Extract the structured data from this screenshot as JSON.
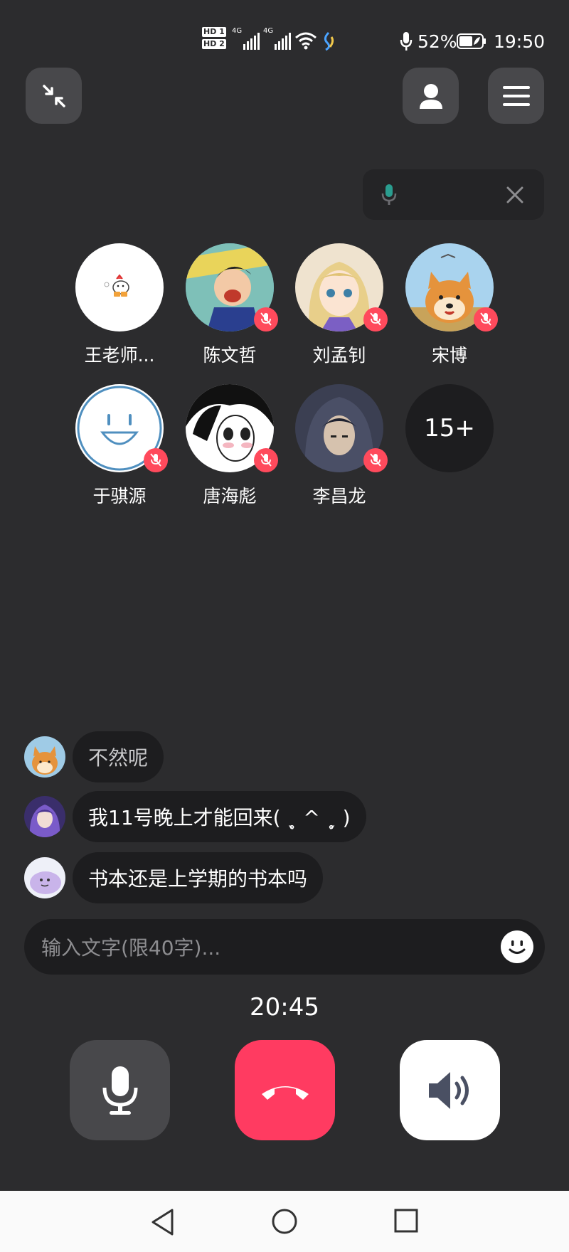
{
  "status_bar": {
    "hd1": "HD 1",
    "hd2": "HD 2",
    "net1": "4G",
    "net2": "4G",
    "battery": "52%",
    "time": "19:50"
  },
  "members": [
    {
      "name": "王老师...",
      "avatar": "white-duck",
      "muted": false
    },
    {
      "name": "陈文哲",
      "avatar": "cartoon-boy",
      "muted": true
    },
    {
      "name": "刘孟钊",
      "avatar": "anime-girl",
      "muted": true
    },
    {
      "name": "宋博",
      "avatar": "shiba-dog",
      "muted": true
    },
    {
      "name": "于骐源",
      "avatar": "smiley-face",
      "muted": true
    },
    {
      "name": "唐海彪",
      "avatar": "manga-boy",
      "muted": true
    },
    {
      "name": "李昌龙",
      "avatar": "hooded-figure",
      "muted": true
    }
  ],
  "more_members": "15+",
  "messages": [
    {
      "text": "不然呢",
      "avatar": "shiba-dog",
      "dim": true
    },
    {
      "text": "我11号晚上才能回来( ˎ̥ ^ ˏ̥ )",
      "avatar": "purple-character",
      "dim": false
    },
    {
      "text": "书本还是上学期的书本吗",
      "avatar": "blob-creature",
      "dim": false
    }
  ],
  "input": {
    "placeholder": "输入文字(限40字)..."
  },
  "call_timer": "20:45",
  "colors": {
    "background": "#2c2c2e",
    "hangup": "#ff3b61",
    "mute_badge": "#ff4a5c",
    "speaking_mic": "#2a9d8f"
  }
}
